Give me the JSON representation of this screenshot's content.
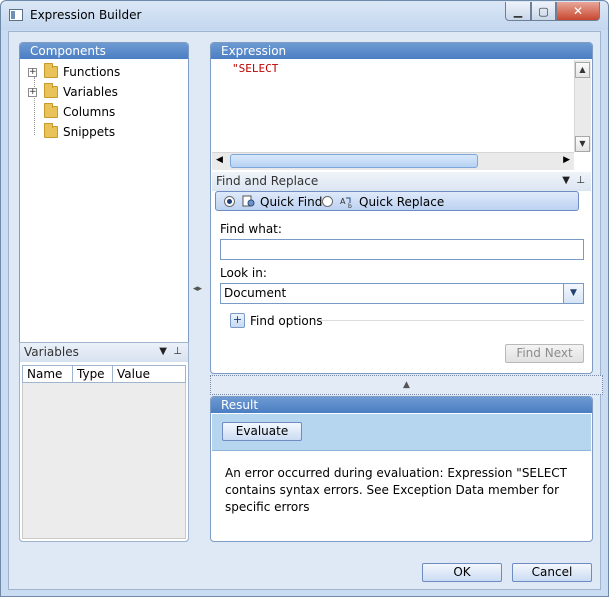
{
  "window": {
    "title": "Expression Builder"
  },
  "colors": {
    "panel_header": "#4a7ec3",
    "error_text": "#c00000",
    "result_toolbar": "#b6d5ee"
  },
  "components": {
    "header": "Components",
    "tree": [
      {
        "label": "Functions",
        "expandable": true
      },
      {
        "label": "Variables",
        "expandable": true
      },
      {
        "label": "Columns",
        "expandable": false
      },
      {
        "label": "Snippets",
        "expandable": false
      }
    ]
  },
  "variables": {
    "header": "Variables",
    "columns": [
      "Name",
      "Type",
      "Value"
    ]
  },
  "expression": {
    "header": "Expression",
    "text": "\"SELECT"
  },
  "find_replace": {
    "header": "Find and Replace",
    "mode_quick_find": "Quick Find",
    "mode_quick_replace": "Quick Replace",
    "find_what_label": "Find what:",
    "find_what_value": "",
    "look_in_label": "Look in:",
    "look_in_value": "Document",
    "find_options_label": "Find options",
    "find_next_label": "Find Next"
  },
  "result": {
    "header": "Result",
    "evaluate_label": "Evaluate",
    "message": "An error occurred during evaluation: Expression \"SELECT  contains syntax errors. See Exception Data member for specific errors"
  },
  "dialog": {
    "ok_label": "OK",
    "cancel_label": "Cancel"
  }
}
